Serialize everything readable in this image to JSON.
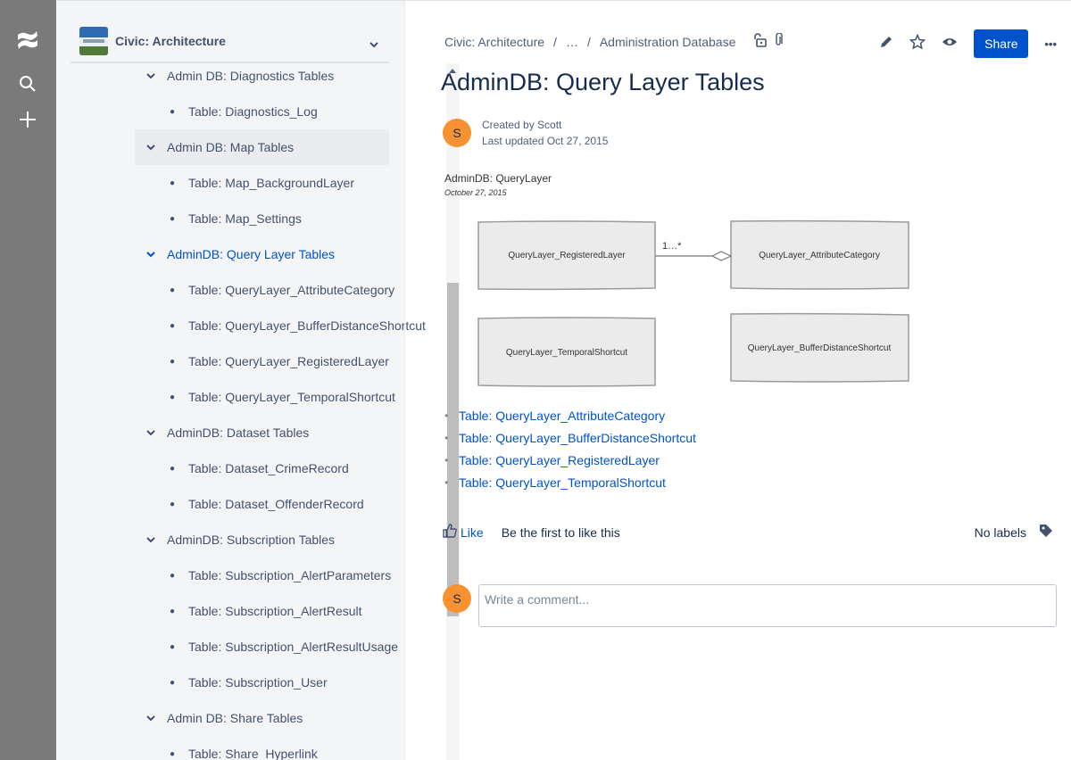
{
  "sidebar": {
    "space_title": "Civic: Architecture",
    "tree": [
      {
        "label": "Admin DB: Diagnostics Tables",
        "level": 1
      },
      {
        "label": "Table: Diagnostics_Log",
        "level": 2
      },
      {
        "label": "Admin DB: Map Tables",
        "level": 1,
        "selected": true
      },
      {
        "label": "Table: Map_BackgroundLayer",
        "level": 2
      },
      {
        "label": "Table: Map_Settings",
        "level": 2
      },
      {
        "label": "AdminDB: Query Layer Tables",
        "level": 1,
        "active": true
      },
      {
        "label": "Table: QueryLayer_AttributeCategory",
        "level": 2
      },
      {
        "label": "Table: QueryLayer_BufferDistanceShortcut",
        "level": 2
      },
      {
        "label": "Table: QueryLayer_RegisteredLayer",
        "level": 2
      },
      {
        "label": "Table: QueryLayer_TemporalShortcut",
        "level": 2
      },
      {
        "label": "AdminDB: Dataset Tables",
        "level": 1
      },
      {
        "label": "Table: Dataset_CrimeRecord",
        "level": 2
      },
      {
        "label": "Table: Dataset_OffenderRecord",
        "level": 2
      },
      {
        "label": "AdminDB: Subscription Tables",
        "level": 1
      },
      {
        "label": "Table: Subscription_AlertParameters",
        "level": 2
      },
      {
        "label": "Table: Subscription_AlertResult",
        "level": 2
      },
      {
        "label": "Table: Subscription_AlertResultUsage",
        "level": 2
      },
      {
        "label": "Table: Subscription_User",
        "level": 2
      },
      {
        "label": "Admin DB: Share Tables",
        "level": 1
      },
      {
        "label": "Table: Share_Hyperlink",
        "level": 2
      }
    ]
  },
  "breadcrumb": {
    "space": "Civic: Architecture",
    "sep": "/",
    "ellipsis": "…",
    "parent": "Administration Database"
  },
  "actions": {
    "share_label": "Share",
    "more_label": "•••"
  },
  "page": {
    "title": "AdminDB: Query Layer Tables",
    "avatar_initial": "S",
    "created_by": "Created by Scott",
    "last_updated": "Last updated Oct 27, 2015"
  },
  "diagram": {
    "title": "AdminDB: QueryLayer",
    "date": "October 27, 2015",
    "boxes": [
      {
        "label": "QueryLayer_RegisteredLayer"
      },
      {
        "label": "QueryLayer_AttributeCategory"
      },
      {
        "label": "QueryLayer_TemporalShortcut"
      },
      {
        "label": "QueryLayer_BufferDistanceShortcut"
      }
    ],
    "relation_label": "1…*"
  },
  "links": [
    "Table: QueryLayer_AttributeCategory",
    "Table: QueryLayer_BufferDistanceShortcut",
    "Table: QueryLayer_RegisteredLayer",
    "Table: QueryLayer_TemporalShortcut"
  ],
  "feedback": {
    "like_label": "Like",
    "like_text": "Be the first to like this",
    "labels_text": "No labels"
  },
  "comment": {
    "placeholder": "Write a comment..."
  },
  "colors": {
    "accent": "#0052cc",
    "avatar": "#f79232",
    "rail": "#7a7a7a"
  }
}
